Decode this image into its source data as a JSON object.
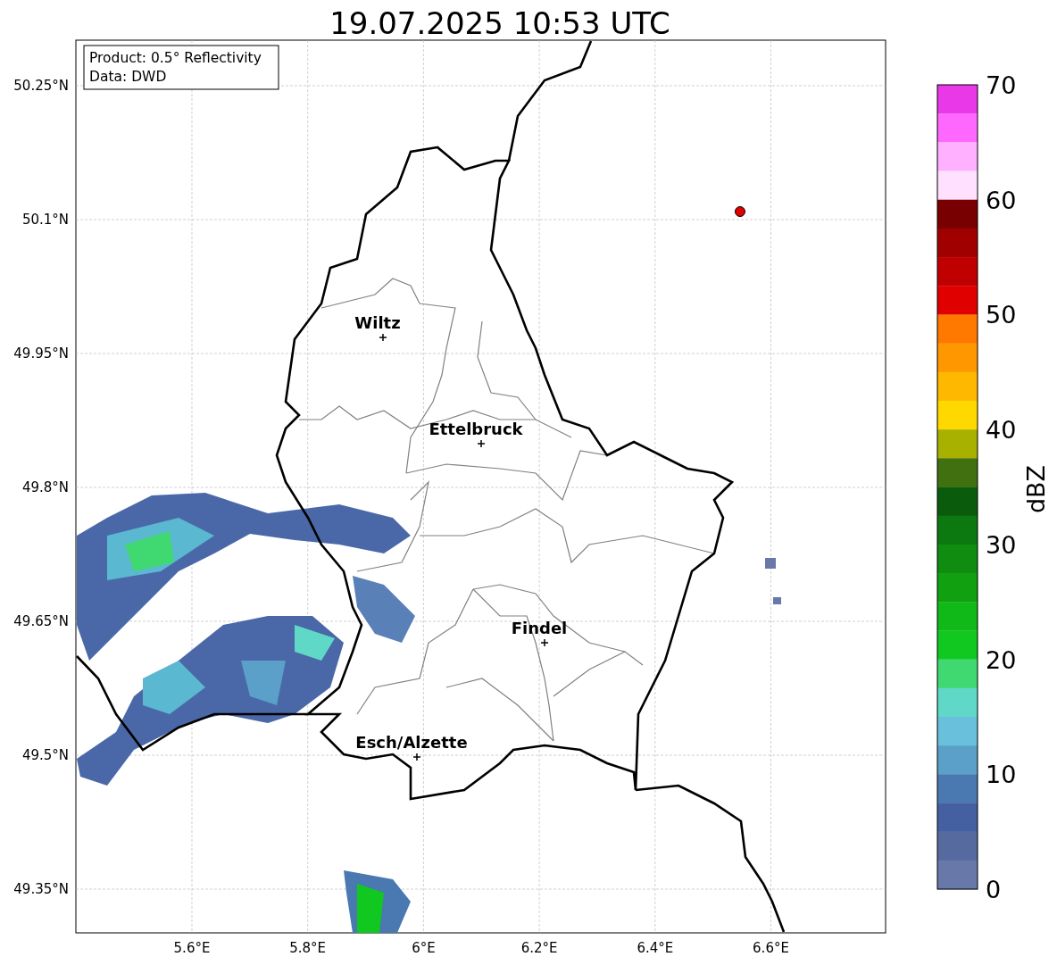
{
  "title": "19.07.2025 10:53 UTC",
  "info_box": [
    "Product: 0.5° Reflectivity",
    "Data: DWD"
  ],
  "lat_ticks": [
    "50.25°N",
    "50.1°N",
    "49.95°N",
    "49.8°N",
    "49.65°N",
    "49.5°N",
    "49.35°N"
  ],
  "lon_ticks": [
    "5.6°E",
    "5.8°E",
    "6°E",
    "6.2°E",
    "6.4°E",
    "6.6°E"
  ],
  "cities": [
    {
      "name": "Wiltz"
    },
    {
      "name": "Ettelbruck"
    },
    {
      "name": "Findel"
    },
    {
      "name": "Esch/Alzette"
    }
  ],
  "colorbar": {
    "label": "dBZ",
    "ticks": [
      "70",
      "60",
      "50",
      "40",
      "30",
      "20",
      "10",
      "0"
    ],
    "bins": [
      {
        "color": "#e838e8"
      },
      {
        "color": "#ff68ff"
      },
      {
        "color": "#ffb0ff"
      },
      {
        "color": "#ffe0ff"
      },
      {
        "color": "#780000"
      },
      {
        "color": "#a00000"
      },
      {
        "color": "#c00000"
      },
      {
        "color": "#e00000"
      },
      {
        "color": "#ff7800"
      },
      {
        "color": "#ff9800"
      },
      {
        "color": "#ffb800"
      },
      {
        "color": "#ffd800"
      },
      {
        "color": "#a8b000"
      },
      {
        "color": "#407010"
      },
      {
        "color": "#0a5c0c"
      },
      {
        "color": "#0c7810"
      },
      {
        "color": "#108c10"
      },
      {
        "color": "#10a010"
      },
      {
        "color": "#10b818"
      },
      {
        "color": "#10c820"
      },
      {
        "color": "#40d870"
      },
      {
        "color": "#60d8c8"
      },
      {
        "color": "#68c0dc"
      },
      {
        "color": "#5aa0c8"
      },
      {
        "color": "#4a78b0"
      },
      {
        "color": "#4560a0"
      },
      {
        "color": "#566aa0"
      },
      {
        "color": "#6878a8"
      }
    ]
  }
}
